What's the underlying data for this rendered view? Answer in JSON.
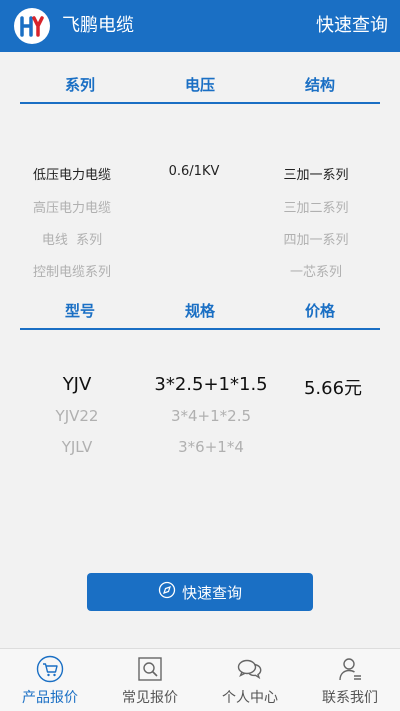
{
  "app": {
    "title": "飞鹏电缆",
    "quick_query": "快速查询",
    "logo_letters": "HY",
    "brand_color": "#1a6fc4",
    "accent_red": "#d8242b"
  },
  "selector1": {
    "headers": [
      "系列",
      "电压",
      "结构"
    ],
    "series": [
      "低压电力电缆",
      "高压电力电缆",
      "电线  系列",
      "控制电缆系列"
    ],
    "voltage": [
      "0.6/1KV"
    ],
    "structure": [
      "三加一系列",
      "三加二系列",
      "四加一系列",
      "一芯系列"
    ]
  },
  "selector2": {
    "headers": [
      "型号",
      "规格",
      "价格"
    ],
    "models": [
      "YJV",
      "YJV22",
      "YJLV"
    ],
    "specs": [
      "3*2.5+1*1.5",
      "3*4+1*2.5",
      "3*6+1*4"
    ],
    "price": "5.66元"
  },
  "query_button": {
    "icon": "compass-icon",
    "label": "快速查询"
  },
  "tabs": [
    {
      "label": "产品报价",
      "icon": "cart-icon",
      "active": true
    },
    {
      "label": "常见报价",
      "icon": "search-doc-icon",
      "active": false
    },
    {
      "label": "个人中心",
      "icon": "chat-bubble-icon",
      "active": false
    },
    {
      "label": "联系我们",
      "icon": "contact-user-icon",
      "active": false
    }
  ]
}
